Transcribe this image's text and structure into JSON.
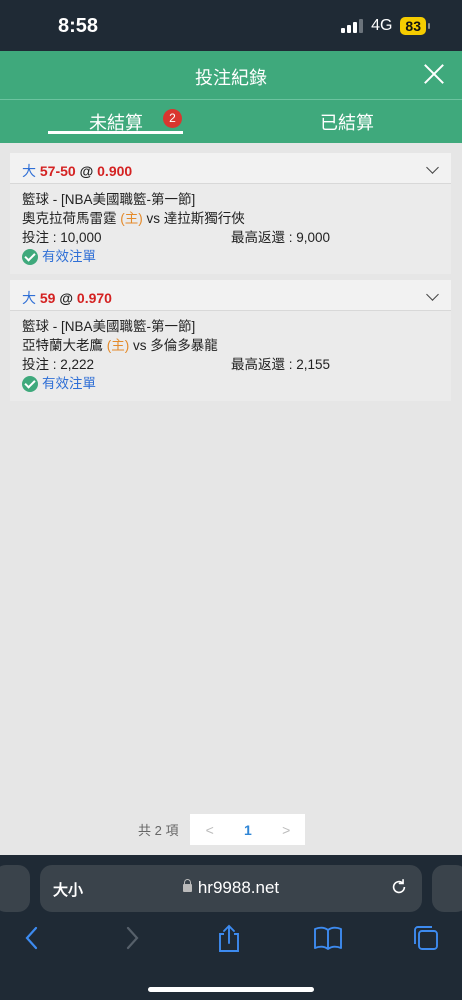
{
  "status": {
    "time": "8:58",
    "network": "4G",
    "battery": "83"
  },
  "header": {
    "title": "投注紀錄"
  },
  "tabs": {
    "unsettled": "未結算",
    "unsettled_badge": "2",
    "settled": "已結算"
  },
  "bets": [
    {
      "type": "大",
      "line": "57-50",
      "at": "@",
      "odds": "0.900",
      "league": "籃球 - [NBA美國職籃-第一節]",
      "home": "奧克拉荷馬雷霆",
      "home_tag": "(主)",
      "vs": "vs",
      "away": "達拉斯獨行俠",
      "stake": "投注 : 10,000",
      "max_return": "最高返還 : 9,000",
      "status": "有效注單"
    },
    {
      "type": "大",
      "line": "59",
      "at": "@",
      "odds": "0.970",
      "league": "籃球 - [NBA美國職籃-第一節]",
      "home": "亞特蘭大老鷹",
      "home_tag": "(主)",
      "vs": "vs",
      "away": "多倫多暴龍",
      "stake": "投注 : 2,222",
      "max_return": "最高返還 : 2,155",
      "status": "有效注單"
    }
  ],
  "pager": {
    "total": "共 2 項",
    "prev": "<",
    "page": "1",
    "next": ">"
  },
  "browser": {
    "text_size": "大小",
    "url": "hr9988.net"
  },
  "colors": {
    "header_green": "#3fa97c",
    "badge_red": "#d9362f",
    "link_blue": "#2f6fd6",
    "odds_red": "#d42222",
    "home_orange": "#e48a2a"
  }
}
